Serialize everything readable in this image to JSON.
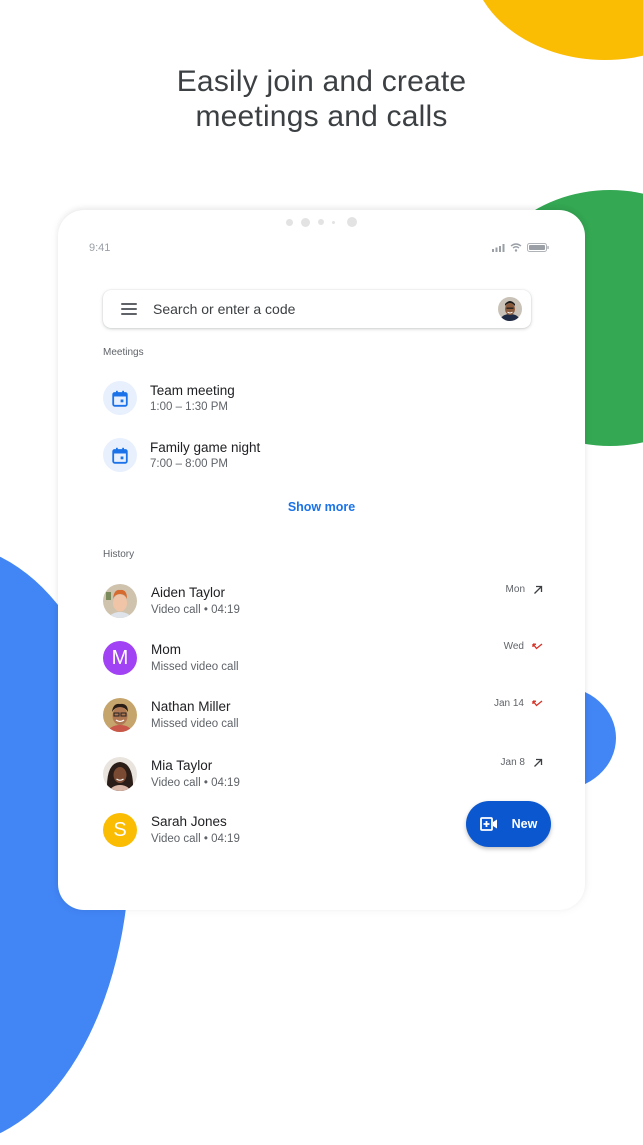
{
  "headline": {
    "line1": "Easily join and create",
    "line2": "meetings and calls"
  },
  "status_bar": {
    "time": "9:41",
    "icons": [
      "signal-icon",
      "wifi-icon",
      "battery-icon"
    ]
  },
  "search": {
    "placeholder": "Search or enter a code",
    "menu_icon": "menu-icon",
    "account_icon": "account-avatar"
  },
  "meetings": {
    "label": "Meetings",
    "items": [
      {
        "title": "Team meeting",
        "time": "1:00 – 1:30 PM",
        "icon": "calendar-icon"
      },
      {
        "title": "Family game night",
        "time": "7:00 – 8:00 PM",
        "icon": "calendar-icon"
      }
    ],
    "show_more": "Show more"
  },
  "history": {
    "label": "History",
    "items": [
      {
        "name": "Aiden Taylor",
        "sub": "Video call •  04:19",
        "date": "Mon",
        "direction": "outgoing",
        "avatar": "photo",
        "initial": ""
      },
      {
        "name": "Mom",
        "sub": "Missed video call",
        "date": "Wed",
        "direction": "missed",
        "avatar": "letter",
        "initial": "M",
        "avatar_color": "#a142f4"
      },
      {
        "name": "Nathan Miller",
        "sub": "Missed video call",
        "date": "Jan 14",
        "direction": "missed",
        "avatar": "photo",
        "initial": ""
      },
      {
        "name": "Mia Taylor",
        "sub": "Video call •  04:19",
        "date": "Jan 8",
        "direction": "outgoing",
        "avatar": "photo",
        "initial": ""
      },
      {
        "name": "Sarah Jones",
        "sub": "Video call •  04:19",
        "date": "",
        "direction": "",
        "avatar": "letter",
        "initial": "S",
        "avatar_color": "#fbbc04"
      }
    ]
  },
  "fab": {
    "label": "New",
    "icon": "video-add-icon"
  },
  "colors": {
    "accent": "#1a73e8",
    "fab": "#0b57d0",
    "missed": "#d93025",
    "yellow": "#fbbc04",
    "green": "#34a853",
    "blue": "#4285f4"
  }
}
